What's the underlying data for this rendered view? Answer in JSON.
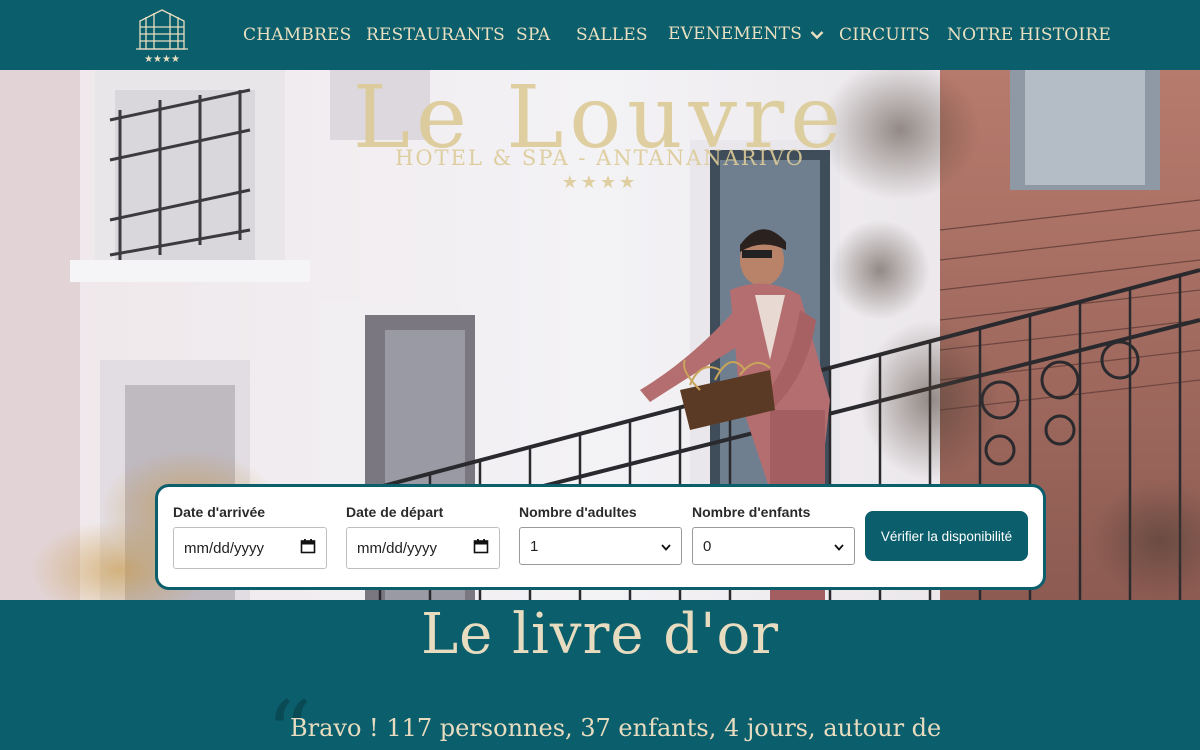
{
  "nav": {
    "items": [
      {
        "label": "CHAMBRES"
      },
      {
        "label": "RESTAURANTS"
      },
      {
        "label": "SPA"
      },
      {
        "label": "SALLES"
      },
      {
        "label": "EVENEMENTS"
      },
      {
        "label": "CIRCUITS"
      },
      {
        "label": "NOTRE HISTOIRE"
      }
    ],
    "logo_stars": "★★★★"
  },
  "hero": {
    "brand_name": "Le Louvre",
    "brand_sub": "HOTEL & SPA - ANTANANARIVO",
    "brand_stars": "★★★★"
  },
  "booking": {
    "arrival": {
      "label": "Date d'arrivée",
      "value": "mm/dd/yyyy"
    },
    "departure": {
      "label": "Date de départ",
      "value": "mm/dd/yyyy"
    },
    "adults": {
      "label": "Nombre d'adultes",
      "value": "1"
    },
    "children": {
      "label": "Nombre d'enfants",
      "value": "0"
    },
    "button_label": "Vérifier la disponibilité"
  },
  "guestbook": {
    "title": "Le livre d'or",
    "quote_mark": "“",
    "text": "Bravo ! 117 personnes, 37 enfants, 4 jours, autour de"
  },
  "colors": {
    "brand_teal": "#0b5e6b",
    "gold": "#dccb97",
    "cream": "#e7dcc0"
  }
}
